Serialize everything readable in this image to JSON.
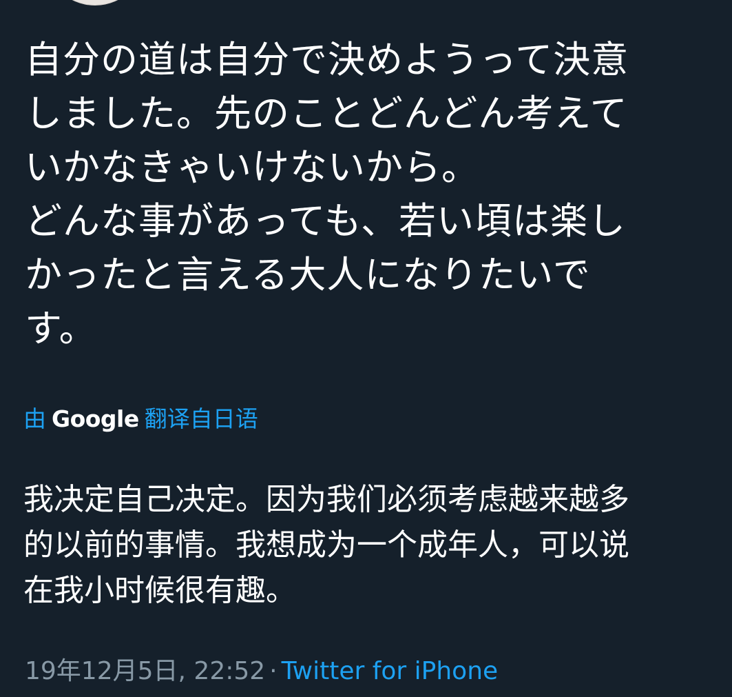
{
  "tweet": {
    "text_lines": [
      "自分の道は自分で決めようって決意",
      "しました。先のことどんどん考えて",
      "いかなきゃいけないから。",
      "どんな事があっても、若い頃は楽し",
      "かったと言える大人になりたいで",
      "す。"
    ],
    "translate": {
      "prefix": "由",
      "brand": "Google",
      "suffix": "翻译自日语"
    },
    "translated_lines": [
      "我决定自己决定。因为我们必须考虑越来越多",
      "的以前的事情。我想成为一个成年人，可以说",
      "在我小时候很有趣。"
    ],
    "meta": {
      "timestamp": "19年12月5日, 22:52",
      "separator": "·",
      "source": "Twitter for iPhone"
    }
  },
  "colors": {
    "background": "#15202b",
    "text": "#ffffff",
    "link": "#1da1f2",
    "muted": "#8899a6"
  }
}
